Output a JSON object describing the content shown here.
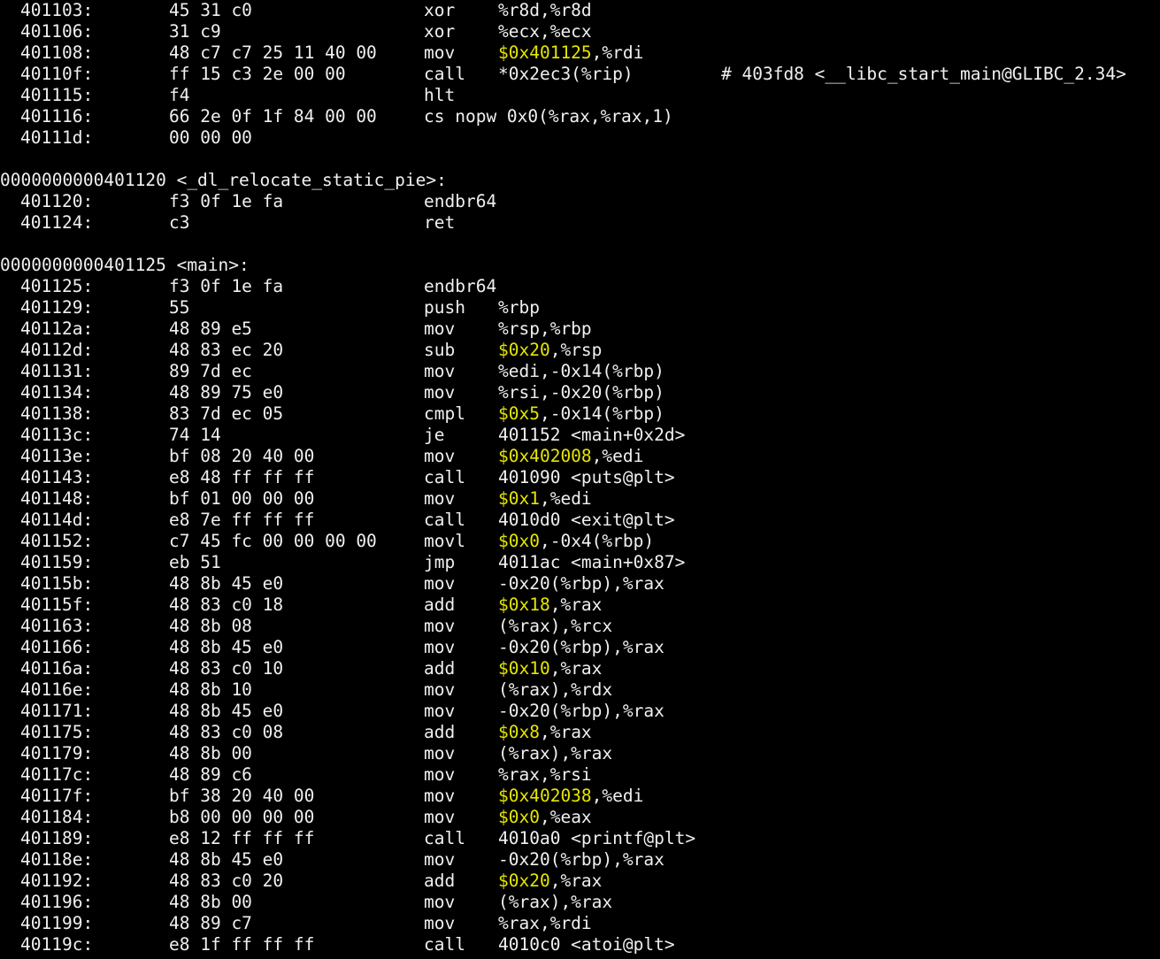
{
  "colors": {
    "background": "#000000",
    "text": "#f0f0f0",
    "immediate": "#e6e600"
  },
  "lines": [
    {
      "type": "insn",
      "addr": "401103:",
      "bytes": "45 31 c0",
      "mnem": "xor",
      "imm": "",
      "ops": "%r8d,%r8d",
      "comment": ""
    },
    {
      "type": "insn",
      "addr": "401106:",
      "bytes": "31 c9",
      "mnem": "xor",
      "imm": "",
      "ops": "%ecx,%ecx",
      "comment": ""
    },
    {
      "type": "insn",
      "addr": "401108:",
      "bytes": "48 c7 c7 25 11 40 00",
      "mnem": "mov",
      "imm": "$0x401125",
      "ops": ",%rdi",
      "comment": ""
    },
    {
      "type": "insn",
      "addr": "40110f:",
      "bytes": "ff 15 c3 2e 00 00",
      "mnem": "call",
      "imm": "",
      "ops": "*0x2ec3(%rip)",
      "comment": "# 403fd8 <__libc_start_main@GLIBC_2.34>"
    },
    {
      "type": "insn",
      "addr": "401115:",
      "bytes": "f4",
      "mnem": "hlt",
      "imm": "",
      "ops": "",
      "comment": ""
    },
    {
      "type": "insn",
      "addr": "401116:",
      "bytes": "66 2e 0f 1f 84 00 00",
      "mnem": "cs nopw 0x0(%rax,%rax,1)",
      "imm": "",
      "ops": "",
      "comment": ""
    },
    {
      "type": "insn",
      "addr": "40111d:",
      "bytes": "00 00 00",
      "mnem": "",
      "imm": "",
      "ops": "",
      "comment": ""
    },
    {
      "type": "blank"
    },
    {
      "type": "label",
      "text": "0000000000401120 <_dl_relocate_static_pie>:"
    },
    {
      "type": "insn",
      "addr": "401120:",
      "bytes": "f3 0f 1e fa",
      "mnem": "endbr64",
      "imm": "",
      "ops": "",
      "comment": ""
    },
    {
      "type": "insn",
      "addr": "401124:",
      "bytes": "c3",
      "mnem": "ret",
      "imm": "",
      "ops": "",
      "comment": ""
    },
    {
      "type": "blank"
    },
    {
      "type": "label",
      "text": "0000000000401125 <main>:"
    },
    {
      "type": "insn",
      "addr": "401125:",
      "bytes": "f3 0f 1e fa",
      "mnem": "endbr64",
      "imm": "",
      "ops": "",
      "comment": ""
    },
    {
      "type": "insn",
      "addr": "401129:",
      "bytes": "55",
      "mnem": "push",
      "imm": "",
      "ops": "%rbp",
      "comment": ""
    },
    {
      "type": "insn",
      "addr": "40112a:",
      "bytes": "48 89 e5",
      "mnem": "mov",
      "imm": "",
      "ops": "%rsp,%rbp",
      "comment": ""
    },
    {
      "type": "insn",
      "addr": "40112d:",
      "bytes": "48 83 ec 20",
      "mnem": "sub",
      "imm": "$0x20",
      "ops": ",%rsp",
      "comment": ""
    },
    {
      "type": "insn",
      "addr": "401131:",
      "bytes": "89 7d ec",
      "mnem": "mov",
      "imm": "",
      "ops": "%edi,-0x14(%rbp)",
      "comment": ""
    },
    {
      "type": "insn",
      "addr": "401134:",
      "bytes": "48 89 75 e0",
      "mnem": "mov",
      "imm": "",
      "ops": "%rsi,-0x20(%rbp)",
      "comment": ""
    },
    {
      "type": "insn",
      "addr": "401138:",
      "bytes": "83 7d ec 05",
      "mnem": "cmpl",
      "imm": "$0x5",
      "ops": ",-0x14(%rbp)",
      "comment": ""
    },
    {
      "type": "insn",
      "addr": "40113c:",
      "bytes": "74 14",
      "mnem": "je",
      "imm": "",
      "ops": "401152 <main+0x2d>",
      "comment": ""
    },
    {
      "type": "insn",
      "addr": "40113e:",
      "bytes": "bf 08 20 40 00",
      "mnem": "mov",
      "imm": "$0x402008",
      "ops": ",%edi",
      "comment": ""
    },
    {
      "type": "insn",
      "addr": "401143:",
      "bytes": "e8 48 ff ff ff",
      "mnem": "call",
      "imm": "",
      "ops": "401090 <puts@plt>",
      "comment": ""
    },
    {
      "type": "insn",
      "addr": "401148:",
      "bytes": "bf 01 00 00 00",
      "mnem": "mov",
      "imm": "$0x1",
      "ops": ",%edi",
      "comment": ""
    },
    {
      "type": "insn",
      "addr": "40114d:",
      "bytes": "e8 7e ff ff ff",
      "mnem": "call",
      "imm": "",
      "ops": "4010d0 <exit@plt>",
      "comment": ""
    },
    {
      "type": "insn",
      "addr": "401152:",
      "bytes": "c7 45 fc 00 00 00 00",
      "mnem": "movl",
      "imm": "$0x0",
      "ops": ",-0x4(%rbp)",
      "comment": ""
    },
    {
      "type": "insn",
      "addr": "401159:",
      "bytes": "eb 51",
      "mnem": "jmp",
      "imm": "",
      "ops": "4011ac <main+0x87>",
      "comment": ""
    },
    {
      "type": "insn",
      "addr": "40115b:",
      "bytes": "48 8b 45 e0",
      "mnem": "mov",
      "imm": "",
      "ops": "-0x20(%rbp),%rax",
      "comment": ""
    },
    {
      "type": "insn",
      "addr": "40115f:",
      "bytes": "48 83 c0 18",
      "mnem": "add",
      "imm": "$0x18",
      "ops": ",%rax",
      "comment": ""
    },
    {
      "type": "insn",
      "addr": "401163:",
      "bytes": "48 8b 08",
      "mnem": "mov",
      "imm": "",
      "ops": "(%rax),%rcx",
      "comment": ""
    },
    {
      "type": "insn",
      "addr": "401166:",
      "bytes": "48 8b 45 e0",
      "mnem": "mov",
      "imm": "",
      "ops": "-0x20(%rbp),%rax",
      "comment": ""
    },
    {
      "type": "insn",
      "addr": "40116a:",
      "bytes": "48 83 c0 10",
      "mnem": "add",
      "imm": "$0x10",
      "ops": ",%rax",
      "comment": ""
    },
    {
      "type": "insn",
      "addr": "40116e:",
      "bytes": "48 8b 10",
      "mnem": "mov",
      "imm": "",
      "ops": "(%rax),%rdx",
      "comment": ""
    },
    {
      "type": "insn",
      "addr": "401171:",
      "bytes": "48 8b 45 e0",
      "mnem": "mov",
      "imm": "",
      "ops": "-0x20(%rbp),%rax",
      "comment": ""
    },
    {
      "type": "insn",
      "addr": "401175:",
      "bytes": "48 83 c0 08",
      "mnem": "add",
      "imm": "$0x8",
      "ops": ",%rax",
      "comment": ""
    },
    {
      "type": "insn",
      "addr": "401179:",
      "bytes": "48 8b 00",
      "mnem": "mov",
      "imm": "",
      "ops": "(%rax),%rax",
      "comment": ""
    },
    {
      "type": "insn",
      "addr": "40117c:",
      "bytes": "48 89 c6",
      "mnem": "mov",
      "imm": "",
      "ops": "%rax,%rsi",
      "comment": ""
    },
    {
      "type": "insn",
      "addr": "40117f:",
      "bytes": "bf 38 20 40 00",
      "mnem": "mov",
      "imm": "$0x402038",
      "ops": ",%edi",
      "comment": ""
    },
    {
      "type": "insn",
      "addr": "401184:",
      "bytes": "b8 00 00 00 00",
      "mnem": "mov",
      "imm": "$0x0",
      "ops": ",%eax",
      "comment": ""
    },
    {
      "type": "insn",
      "addr": "401189:",
      "bytes": "e8 12 ff ff ff",
      "mnem": "call",
      "imm": "",
      "ops": "4010a0 <printf@plt>",
      "comment": ""
    },
    {
      "type": "insn",
      "addr": "40118e:",
      "bytes": "48 8b 45 e0",
      "mnem": "mov",
      "imm": "",
      "ops": "-0x20(%rbp),%rax",
      "comment": ""
    },
    {
      "type": "insn",
      "addr": "401192:",
      "bytes": "48 83 c0 20",
      "mnem": "add",
      "imm": "$0x20",
      "ops": ",%rax",
      "comment": ""
    },
    {
      "type": "insn",
      "addr": "401196:",
      "bytes": "48 8b 00",
      "mnem": "mov",
      "imm": "",
      "ops": "(%rax),%rax",
      "comment": ""
    },
    {
      "type": "insn",
      "addr": "401199:",
      "bytes": "48 89 c7",
      "mnem": "mov",
      "imm": "",
      "ops": "%rax,%rdi",
      "comment": ""
    },
    {
      "type": "insn",
      "addr": "40119c:",
      "bytes": "e8 1f ff ff ff",
      "mnem": "call",
      "imm": "",
      "ops": "4010c0 <atoi@plt>",
      "comment": ""
    }
  ]
}
